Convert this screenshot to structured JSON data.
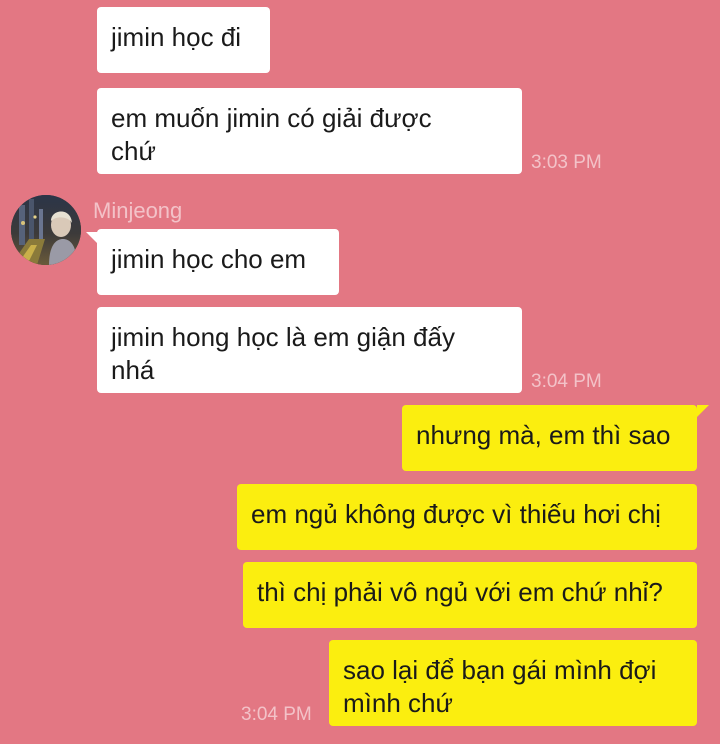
{
  "colors": {
    "background": "#e37783",
    "incoming_bubble": "#ffffff",
    "outgoing_bubble": "#fbee0f",
    "meta_text": "#f3c2c8"
  },
  "messages": [
    {
      "text": "jimin học đi"
    },
    {
      "text": "em muốn jimin có giải được chứ",
      "time": "3:03 PM"
    },
    {
      "sender": "Minjeong",
      "avatar_icon": "profile-photo-icon",
      "text": "jimin học cho em"
    },
    {
      "text": "jimin hong học là em giận đấy nhá",
      "time": "3:04 PM"
    },
    {
      "text": "nhưng mà, em thì sao"
    },
    {
      "text": "em ngủ không được vì thiếu hơi chị"
    },
    {
      "text": "thì chị phải vô ngủ với em chứ nhỉ?"
    },
    {
      "text": "sao lại để bạn gái mình đợi mình chứ",
      "time": "3:04 PM"
    }
  ]
}
